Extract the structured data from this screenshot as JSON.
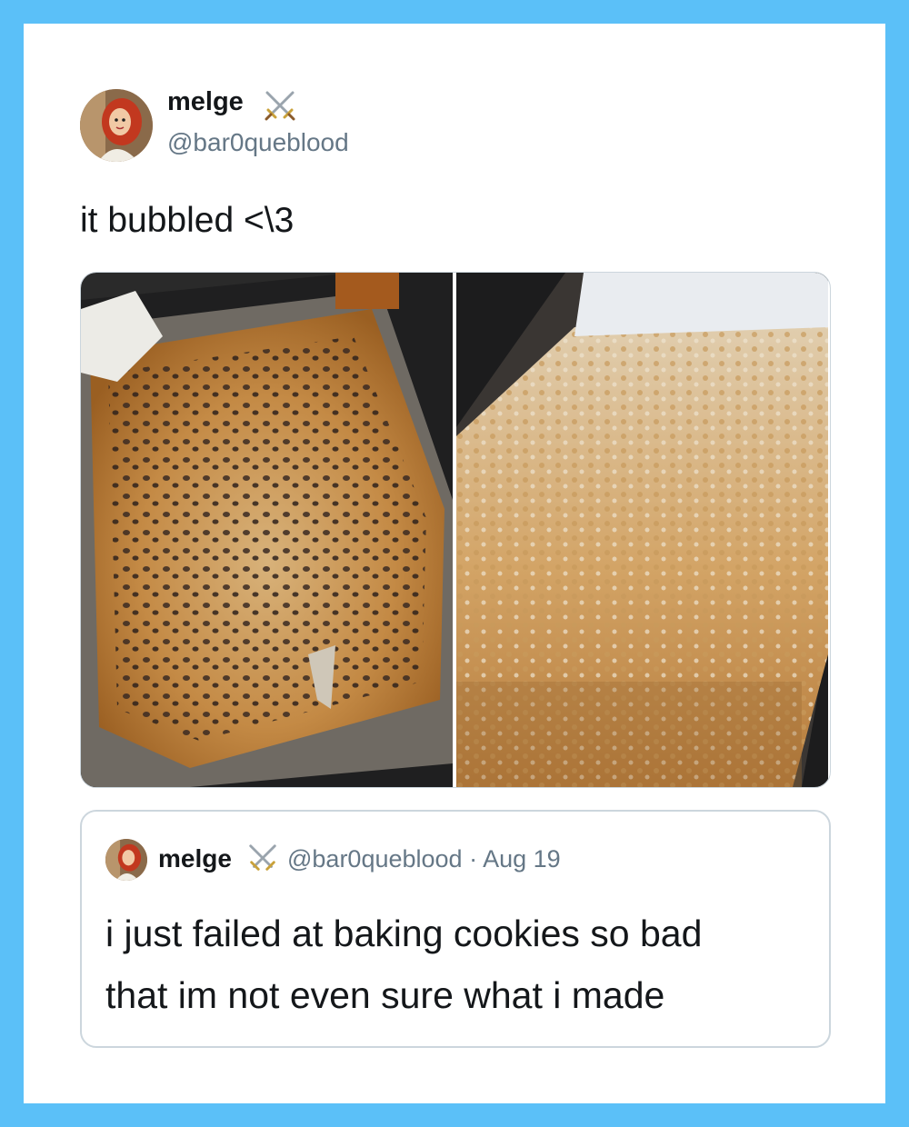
{
  "tweet": {
    "author": {
      "name": "melge",
      "name_icon": "crossed-swords-icon",
      "handle": "@bar0queblood",
      "avatar_icon": "cartoon-redhead-avatar"
    },
    "text": "it bubbled <\\3",
    "media": [
      {
        "name": "photo-bubbling-dough-in-pan-1"
      },
      {
        "name": "photo-bubbling-dough-in-pan-2"
      }
    ]
  },
  "quoted_tweet": {
    "author": {
      "name": "melge",
      "name_icon": "crossed-swords-icon",
      "handle": "@bar0queblood"
    },
    "separator": "·",
    "date": "Aug 19",
    "text_line1": "i just failed at baking cookies so bad",
    "text_line2": "that im not even sure what i made"
  },
  "colors": {
    "frame": "#5BC0F8",
    "card": "#ffffff",
    "text_primary": "#14171a",
    "text_secondary": "#657786",
    "border": "#ccd6dd"
  }
}
